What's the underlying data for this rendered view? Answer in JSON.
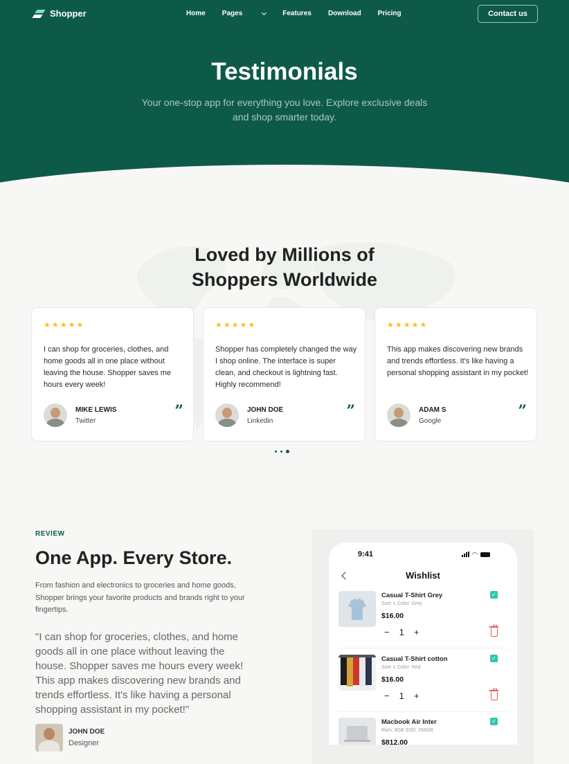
{
  "nav": {
    "logo": "Shopper",
    "links": [
      "Home",
      "Pages",
      "Features",
      "Download",
      "Pricing"
    ],
    "contact": "Contact us"
  },
  "hero": {
    "title": "Testimonials",
    "subtitle": "Your one-stop app for everything you love. Explore exclusive deals and shop smarter today."
  },
  "testimonials": {
    "title_line1": "Loved by Millions of",
    "title_line2": "Shoppers Worldwide",
    "rating": 5,
    "cards": [
      {
        "text": "I can shop for groceries, clothes, and home goods all in one place without leaving the house. Shopper saves me hours every week!",
        "name": "MIKE LEWIS",
        "source": "Twitter"
      },
      {
        "text": "Shopper has completely changed the way I shop online. The interface is super clean, and checkout is lightning fast. Highly recommend!",
        "name": "JOHN DOE",
        "source": "Linkedin"
      },
      {
        "text": "This app makes discovering new brands and trends effortless. It's like having a personal shopping assistant in my pocket!",
        "name": "ADAM S",
        "source": "Google"
      }
    ],
    "slider": {
      "count": 3,
      "active": 3
    }
  },
  "review": {
    "eyebrow": "REVIEW",
    "title": "One App. Every Store.",
    "description": "From fashion and electronics to groceries and home goods, Shopper brings your favorite products and brands right to your fingertips.",
    "quote": "\"I can shop for groceries, clothes, and home goods all in one place without leaving the house. Shopper saves me hours every week! This app makes discovering new brands and trends effortless. It's like having a personal shopping assistant in my pocket!\"",
    "author_name": "JOHN DOE",
    "author_role": "Designer"
  },
  "phone": {
    "time": "9:41",
    "title": "Wishlist",
    "items": [
      {
        "name": "Casual T-Shirt Grey",
        "meta": "Size: L    Color: Grey",
        "price": "$16.00",
        "qty": "1"
      },
      {
        "name": "Casual T-Shirt cotton",
        "meta": "Size: L    Color: Red",
        "price": "$16.00",
        "qty": "1"
      },
      {
        "name": "Macbook Air Inter",
        "meta": "Ram: 8GB    SSD: 256GB",
        "price": "$812.00"
      }
    ],
    "stepper": {
      "minus": "−",
      "plus": "+"
    }
  },
  "colors": {
    "brand": "#0e5a48",
    "star": "#f4c11f",
    "check": "#30c8a6",
    "delete": "#e05b5b"
  }
}
